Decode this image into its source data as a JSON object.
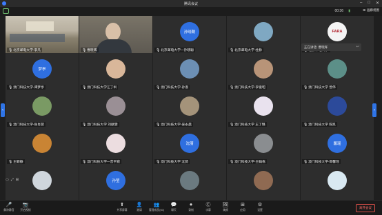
{
  "window": {
    "title": "腾讯会议"
  },
  "infobar": {
    "timer": "00:36",
    "view_label": "画廊视图"
  },
  "toast": {
    "text": "正在讲话: 曹晓辉"
  },
  "participants": [
    {
      "name": "北京邮电大学-李凡",
      "avatar_text": "",
      "color": "#000",
      "kind": "room"
    },
    {
      "name": "曹晓辉",
      "avatar_text": "",
      "color": "#000",
      "kind": "person"
    },
    {
      "name": "北京邮电大学一孙晓聪",
      "avatar_text": "孙晓聪",
      "color": "#2f6fe0",
      "kind": "circle"
    },
    {
      "name": "北京邮电大学 杜静",
      "avatar_text": "",
      "color": "#7fa8c2",
      "kind": "circle"
    },
    {
      "name": "北京邮电大学-",
      "avatar_text": "FARA",
      "color": "#f4f4f4",
      "kind": "circle"
    },
    {
      "name": "澳门科技大学-谭梦亭",
      "avatar_text": "梦亭",
      "color": "#2f6fe0",
      "kind": "circle"
    },
    {
      "name": "澳门科技大学江丁圳",
      "avatar_text": "",
      "color": "#d9b79a",
      "kind": "circle"
    },
    {
      "name": "澳门科技大学-孙淑",
      "avatar_text": "",
      "color": "#6c8fb4",
      "kind": "circle"
    },
    {
      "name": "澳门科技大学-李俊昭",
      "avatar_text": "",
      "color": "#b89478",
      "kind": "circle"
    },
    {
      "name": "澳门科技大学 曾伟",
      "avatar_text": "",
      "color": "#5c8f88",
      "kind": "circle"
    },
    {
      "name": "澳门科技大学-张肖蓉",
      "avatar_text": "",
      "color": "#7a9a64",
      "kind": "circle"
    },
    {
      "name": "澳门科技大学 刘献雯",
      "avatar_text": "",
      "color": "#9a8f95",
      "kind": "circle"
    },
    {
      "name": "澳门科技大学-妥永晨",
      "avatar_text": "",
      "color": "#a4937a",
      "kind": "circle"
    },
    {
      "name": "澳门科技大学 王丁璐",
      "avatar_text": "",
      "color": "#e9e2ee",
      "kind": "circle"
    },
    {
      "name": "澳门科技大学 陈凯",
      "avatar_text": "",
      "color": "#2c4a9a",
      "kind": "circle"
    },
    {
      "name": "王颖静",
      "avatar_text": "",
      "color": "#c98434",
      "kind": "circle"
    },
    {
      "name": "澳门科技大学一曾宇宸",
      "avatar_text": "",
      "color": "#ecdde0",
      "kind": "circle"
    },
    {
      "name": "澳门科技大学 沈漪",
      "avatar_text": "沈漪",
      "color": "#2f6fe0",
      "kind": "circle"
    },
    {
      "name": "澳门科技大学-王翰栋",
      "avatar_text": "",
      "color": "#8a8d90",
      "kind": "circle"
    },
    {
      "name": "澳门科技大学-郎馨瑶",
      "avatar_text": "馨瑶",
      "color": "#2f6fe0",
      "kind": "circle"
    },
    {
      "name": "",
      "avatar_text": "",
      "color": "#cfd6dc",
      "kind": "circle"
    },
    {
      "name": "",
      "avatar_text": "孙莹",
      "color": "#2f6fe0",
      "kind": "circle"
    },
    {
      "name": "",
      "avatar_text": "",
      "color": "#6b7a80",
      "kind": "circle"
    },
    {
      "name": "",
      "avatar_text": "",
      "color": "#8f6a52",
      "kind": "circle"
    },
    {
      "name": "",
      "avatar_text": "",
      "color": "#d9e9f2",
      "kind": "circle"
    }
  ],
  "toolbar": {
    "left": [
      {
        "icon": "mic-icon",
        "glyph": "🎤",
        "label": "解除静音"
      },
      {
        "icon": "camera-icon",
        "glyph": "📷",
        "label": "开启视频"
      }
    ],
    "center": [
      {
        "icon": "share-screen-icon",
        "glyph": "⬆",
        "label": "共享屏幕"
      },
      {
        "icon": "invite-icon",
        "glyph": "👤",
        "label": "邀请"
      },
      {
        "icon": "members-icon",
        "glyph": "👥",
        "label": "管理成员(60)"
      },
      {
        "icon": "chat-icon",
        "glyph": "💬",
        "label": "聊天"
      },
      {
        "icon": "record-icon",
        "glyph": "⏺",
        "label": "录制"
      },
      {
        "icon": "caption-icon",
        "glyph": "Ⓒ",
        "label": "字幕"
      },
      {
        "icon": "effects-icon",
        "glyph": "🖼",
        "label": "美颜"
      },
      {
        "icon": "apps-icon",
        "glyph": "⊞",
        "label": "应用"
      },
      {
        "icon": "settings-icon",
        "glyph": "⚙",
        "label": "设置"
      }
    ],
    "leave_label": "离开会议"
  }
}
